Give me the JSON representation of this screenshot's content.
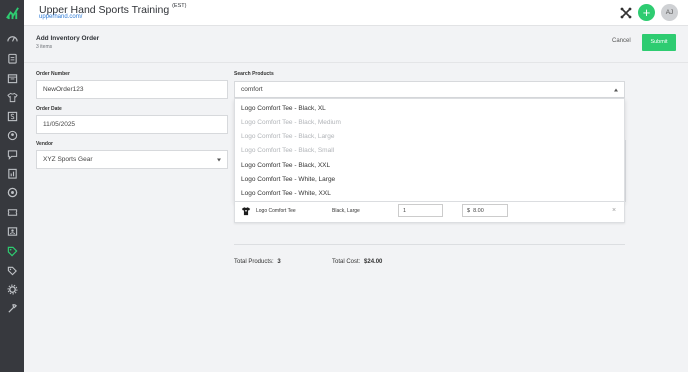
{
  "header": {
    "title": "Upper Hand Sports Training",
    "timezone": "(EST)",
    "url": "upperhand.com/",
    "add_label": "+",
    "avatar_initials": "AJ"
  },
  "sidebar": {
    "icons": [
      "dashboard-icon",
      "clipboard-icon",
      "calendar-icon",
      "shirt-icon",
      "dollar-icon",
      "team-icon",
      "chat-icon",
      "report-icon",
      "camera-icon",
      "ticket-icon",
      "contact-card-icon",
      "tag-icon",
      "tags-icon",
      "settings-icon",
      "tools-icon"
    ],
    "active_index": 11,
    "accent": "#2ecc71"
  },
  "page": {
    "title": "Add Inventory Order",
    "subtitle": "3 items",
    "cancel_label": "Cancel",
    "submit_label": "Submit"
  },
  "form": {
    "order_number_label": "Order Number",
    "order_number_value": "NewOrder123",
    "order_date_label": "Order Date",
    "order_date_value": "11/05/2025",
    "vendor_label": "Vendor",
    "vendor_value": "XYZ Sports Gear",
    "search_label": "Search Products",
    "search_value": "comfort"
  },
  "dropdown": {
    "items": [
      {
        "label": "Logo Comfort Tee - Black, XL",
        "enabled": true
      },
      {
        "label": "Logo Comfort Tee - Black, Medium",
        "enabled": false
      },
      {
        "label": "Logo Comfort Tee - Black, Large",
        "enabled": false
      },
      {
        "label": "Logo Comfort Tee - Black, Small",
        "enabled": false
      },
      {
        "label": "Logo Comfort Tee - Black, XXL",
        "enabled": true
      },
      {
        "label": "Logo Comfort Tee - White, Large",
        "enabled": true
      },
      {
        "label": "Logo Comfort Tee - White, XXL",
        "enabled": true
      }
    ]
  },
  "line_item": {
    "name": "Logo Comfort Tee",
    "variant": "Black, Large",
    "quantity": "1",
    "currency": "$",
    "cost": "8.00",
    "remove": "×"
  },
  "totals": {
    "products_label": "Total Products:",
    "products_value": "3",
    "cost_label": "Total Cost:",
    "cost_value": "$24.00"
  }
}
